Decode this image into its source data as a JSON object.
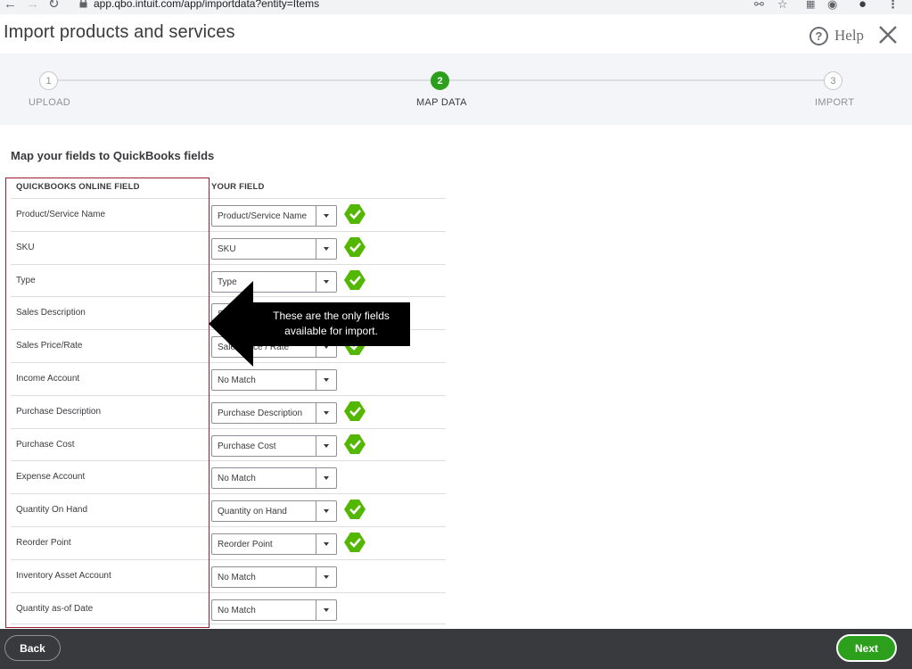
{
  "browser": {
    "back_icon": "arrow-left-icon",
    "forward_icon": "arrow-right-icon",
    "reload_icon": "reload-icon",
    "url": "app.qbo.intuit.com/app/importdata?entity=Items"
  },
  "header": {
    "title": "Import products and services",
    "help_label": "Help",
    "help_glyph": "?"
  },
  "stepper": {
    "steps": [
      {
        "number": "1",
        "label": "UPLOAD"
      },
      {
        "number": "2",
        "label": "MAP DATA"
      },
      {
        "number": "3",
        "label": "IMPORT"
      }
    ],
    "active_step": 2
  },
  "mapping": {
    "title": "Map your fields to QuickBooks fields",
    "col_qb": "QUICKBOOKS ONLINE FIELD",
    "col_yours": "YOUR FIELD",
    "rows": [
      {
        "qb_field": "Product/Service Name",
        "your_field": "Product/Service Name",
        "matched": true
      },
      {
        "qb_field": "SKU",
        "your_field": "SKU",
        "matched": true
      },
      {
        "qb_field": "Type",
        "your_field": "Type",
        "matched": true
      },
      {
        "qb_field": "Sales Description",
        "your_field": "Sales Description",
        "matched": false
      },
      {
        "qb_field": "Sales Price/Rate",
        "your_field": "Sales Price / Rate",
        "matched": true
      },
      {
        "qb_field": "Income Account",
        "your_field": "No Match",
        "matched": false
      },
      {
        "qb_field": "Purchase Description",
        "your_field": "Purchase Description",
        "matched": true
      },
      {
        "qb_field": "Purchase Cost",
        "your_field": "Purchase Cost",
        "matched": true
      },
      {
        "qb_field": "Expense Account",
        "your_field": "No Match",
        "matched": false
      },
      {
        "qb_field": "Quantity On Hand",
        "your_field": "Quantity on Hand",
        "matched": true
      },
      {
        "qb_field": "Reorder Point",
        "your_field": "Reorder Point",
        "matched": true
      },
      {
        "qb_field": "Inventory Asset Account",
        "your_field": "No Match",
        "matched": false
      },
      {
        "qb_field": "Quantity as-of Date",
        "your_field": "No Match",
        "matched": false
      }
    ]
  },
  "callout": {
    "line1": "These are the only fields",
    "line2": "available  for import."
  },
  "footer": {
    "back_label": "Back",
    "next_label": "Next"
  },
  "colors": {
    "accent_green": "#2ca01c",
    "check_green": "#53b700",
    "highlight_border": "#9b1c2e",
    "footer_bg": "#393a3d"
  }
}
